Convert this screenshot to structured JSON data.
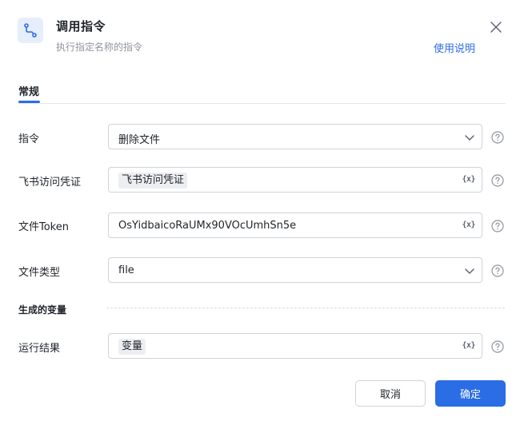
{
  "header": {
    "title": "调用指令",
    "subtitle": "执行指定名称的指令",
    "help_link": "使用说明"
  },
  "tabs": [
    {
      "label": "常规",
      "active": true
    }
  ],
  "form": {
    "command": {
      "label": "指令",
      "value": "删除文件"
    },
    "credential": {
      "label": "飞书访问凭证",
      "value": "飞书访问凭证",
      "var_button": "{x}"
    },
    "file_token": {
      "label": "文件Token",
      "value": "OsYidbaicoRaUMx90VOcUmhSn5e",
      "var_button": "{x}"
    },
    "file_type": {
      "label": "文件类型",
      "value": "file"
    }
  },
  "output_section": {
    "title": "生成的变量",
    "result": {
      "label": "运行结果",
      "value": "变量",
      "var_button": "{x}"
    }
  },
  "footer": {
    "cancel_label": "取消",
    "ok_label": "确定"
  },
  "colors": {
    "accent": "#2b6de5",
    "icon_bg": "#e6edfb"
  },
  "icons": {
    "header": "flow-route-icon",
    "close": "close-icon",
    "dropdown": "chevron-down-icon",
    "help": "question-circle-icon"
  }
}
